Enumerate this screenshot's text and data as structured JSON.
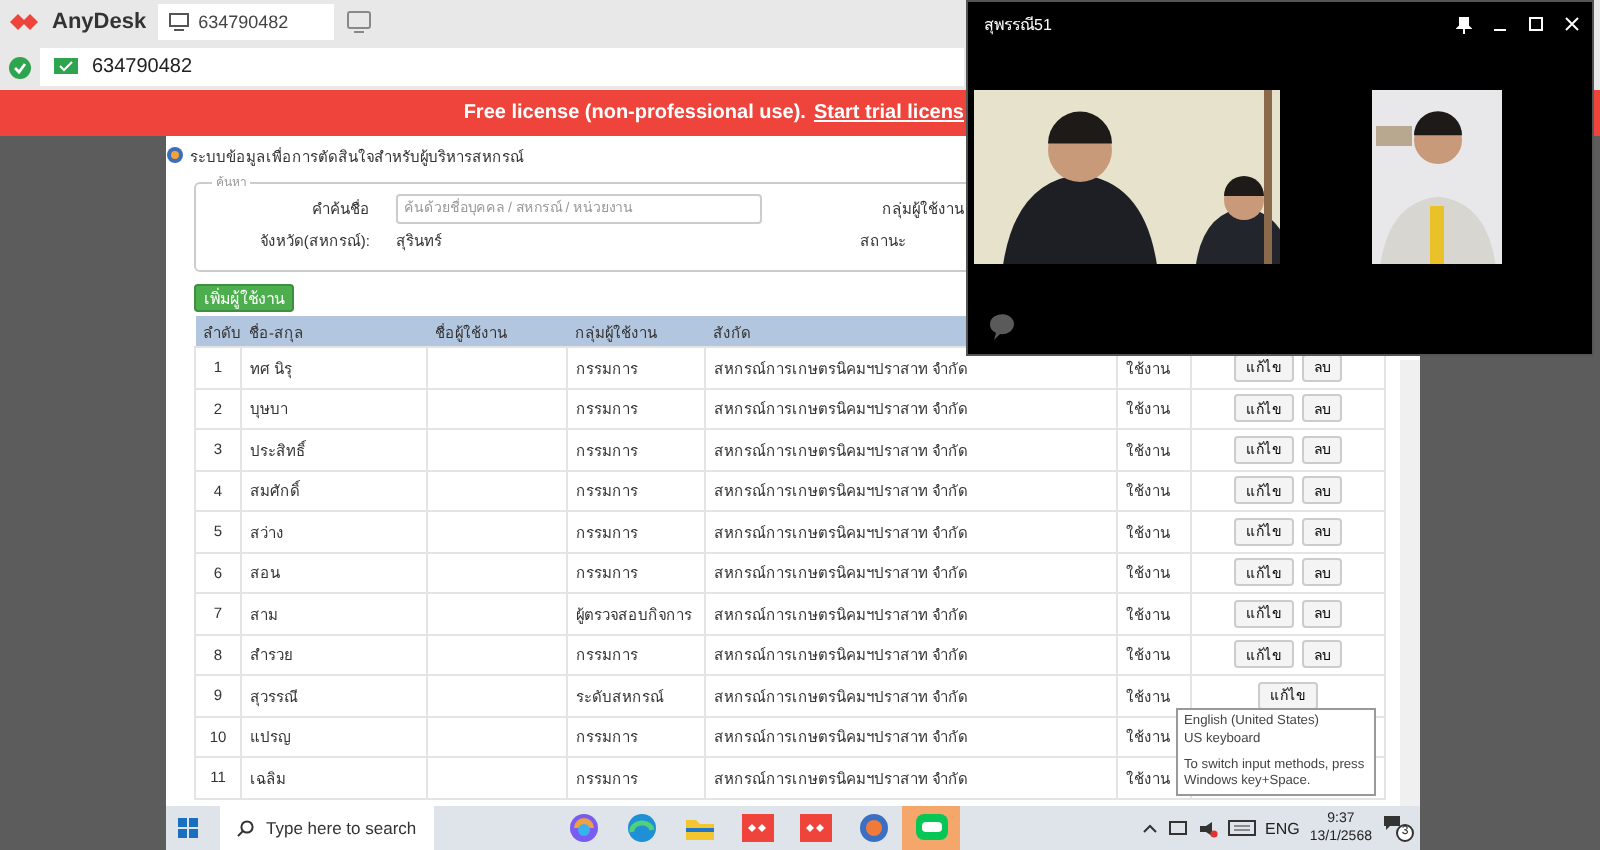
{
  "anydesk": {
    "app_name": "AnyDesk",
    "tab": {
      "label": "634790482",
      "selected": true
    },
    "address": "634790482",
    "banner": {
      "text": "Free license (non-professional use).",
      "link": "Start trial licens"
    }
  },
  "page": {
    "title": "ระบบข้อมูลเพื่อการตัดสินใจสำหรับผู้บริหารสหกรณ์",
    "search": {
      "legend": "ค้นหา",
      "keyword_label": "คำค้นชื่อ",
      "keyword_placeholder": "ค้นด้วยชื่อบุคคล / สหกรณ์ / หน่วยงาน",
      "group_label": "กลุ่มผู้ใช้งาน",
      "province_label": "จังหวัด(สหกรณ์):",
      "province_value": "สุรินทร์",
      "status_label": "สถานะ"
    },
    "add_button": "เพิ่มผู้ใช้งาน",
    "table": {
      "columns": [
        "ลำดับ",
        "ชื่อ-สกุล",
        "ชื่อผู้ใช้งาน",
        "กลุ่มผู้ใช้งาน",
        "สังกัด"
      ],
      "rows": [
        {
          "no": "1",
          "name": "ทศ นิรุ",
          "group": "กรรมการ",
          "affiliation": "สหกรณ์การเกษตรนิคมฯปราสาท จำกัด",
          "status": "ใช้งาน",
          "actions": [
            "แก้ไข",
            "ลบ"
          ]
        },
        {
          "no": "2",
          "name": "บุษบา",
          "group": "กรรมการ",
          "affiliation": "สหกรณ์การเกษตรนิคมฯปราสาท จำกัด",
          "status": "ใช้งาน",
          "actions": [
            "แก้ไข",
            "ลบ"
          ]
        },
        {
          "no": "3",
          "name": "ประสิทธิ์",
          "group": "กรรมการ",
          "affiliation": "สหกรณ์การเกษตรนิคมฯปราสาท จำกัด",
          "status": "ใช้งาน",
          "actions": [
            "แก้ไข",
            "ลบ"
          ]
        },
        {
          "no": "4",
          "name": "สมศักดิ์",
          "group": "กรรมการ",
          "affiliation": "สหกรณ์การเกษตรนิคมฯปราสาท จำกัด",
          "status": "ใช้งาน",
          "actions": [
            "แก้ไข",
            "ลบ"
          ]
        },
        {
          "no": "5",
          "name": "สว่าง",
          "group": "กรรมการ",
          "affiliation": "สหกรณ์การเกษตรนิคมฯปราสาท จำกัด",
          "status": "ใช้งาน",
          "actions": [
            "แก้ไข",
            "ลบ"
          ]
        },
        {
          "no": "6",
          "name": "สอน",
          "group": "กรรมการ",
          "affiliation": "สหกรณ์การเกษตรนิคมฯปราสาท จำกัด",
          "status": "ใช้งาน",
          "actions": [
            "แก้ไข",
            "ลบ"
          ]
        },
        {
          "no": "7",
          "name": "สาม",
          "group": "ผู้ตรวจสอบกิจการ",
          "affiliation": "สหกรณ์การเกษตรนิคมฯปราสาท จำกัด",
          "status": "ใช้งาน",
          "actions": [
            "แก้ไข",
            "ลบ"
          ]
        },
        {
          "no": "8",
          "name": "สำรวย",
          "group": "กรรมการ",
          "affiliation": "สหกรณ์การเกษตรนิคมฯปราสาท จำกัด",
          "status": "ใช้งาน",
          "actions": [
            "แก้ไข",
            "ลบ"
          ]
        },
        {
          "no": "9",
          "name": "สุวรรณี",
          "group": "ระดับสหกรณ์",
          "affiliation": "สหกรณ์การเกษตรนิคมฯปราสาท จำกัด",
          "status": "ใช้งาน",
          "actions": [
            "แก้ไข"
          ]
        },
        {
          "no": "10",
          "name": "แปรญ",
          "group": "กรรมการ",
          "affiliation": "สหกรณ์การเกษตรนิคมฯปราสาท จำกัด",
          "status": "ใช้งาน"
        },
        {
          "no": "11",
          "name": "เฉลิม",
          "group": "กรรมการ",
          "affiliation": "สหกรณ์การเกษตรนิคมฯปราสาท จำกัด",
          "status": "ใช้งาน"
        }
      ]
    }
  },
  "video_call": {
    "title": "สุพรรณี51"
  },
  "tooltip": {
    "lines": [
      "English (United States)",
      "US keyboard",
      "To switch input methods, press Windows key+Space."
    ]
  },
  "taskbar": {
    "search_placeholder": "Type here to search",
    "apps": [
      {
        "kind": "swirl",
        "selected": false
      },
      {
        "kind": "browser",
        "selected": false
      },
      {
        "kind": "folder",
        "selected": false
      },
      {
        "kind": "remote",
        "selected": false
      },
      {
        "kind": "remote",
        "selected": false
      },
      {
        "kind": "globe",
        "selected": false
      },
      {
        "kind": "chat",
        "selected": true
      }
    ],
    "language": "ENG",
    "time": "9:37",
    "date": "13/1/2568",
    "notifications": "3"
  }
}
